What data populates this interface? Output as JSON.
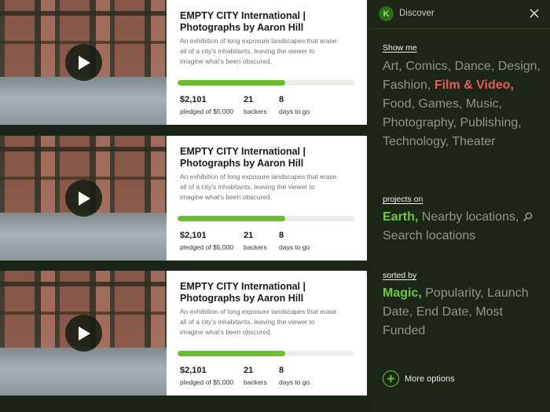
{
  "projects": [
    {
      "title": "EMPTY CITY International | Photographs by Aaron Hill",
      "description": "An exhibition of long exposure landscapes that erase all of a city's inhabitants, leaving the viewer to imagine what's been obscured.",
      "progress_fraction": 0.61,
      "pledged": "$2,101",
      "pledged_label": "pledged of $5,000",
      "backers": "21",
      "backers_label": "backers",
      "days": "8",
      "days_label": "days to go"
    },
    {
      "title": "EMPTY CITY International | Photographs by Aaron Hill",
      "description": "An exhibition of long exposure landscapes that erase all of a city's inhabitants, leaving the viewer to imagine what's been obscured.",
      "progress_fraction": 0.61,
      "pledged": "$2,101",
      "pledged_label": "pledged of $5,000",
      "backers": "21",
      "backers_label": "backers",
      "days": "8",
      "days_label": "days to go"
    },
    {
      "title": "EMPTY CITY International | Photographs by Aaron Hill",
      "description": "An exhibition of long exposure landscapes that erase all of a city's inhabitants, leaving the viewer to imagine what's been obscured.",
      "progress_fraction": 0.61,
      "pledged": "$2,101",
      "pledged_label": "pledged of $5,000",
      "backers": "21",
      "backers_label": "backers",
      "days": "8",
      "days_label": "days to go"
    }
  ],
  "panel": {
    "logo_letter": "K",
    "title": "Discover",
    "close_icon": "close-icon",
    "show_me": {
      "label": "Show me",
      "items": [
        "Art,",
        "Comics,",
        "Dance,",
        "Design,",
        "Fashion,",
        "Film & Video,",
        "Food,",
        "Games,",
        "Music,",
        "Photography,",
        "Publishing,",
        "Technology,",
        "Theater"
      ],
      "selected": "Film & Video,"
    },
    "projects_on": {
      "label": "projects on",
      "items": [
        "Earth,",
        "Nearby locations,",
        "Search locations"
      ],
      "selected": "Earth,"
    },
    "sorted_by": {
      "label": "sorted by",
      "items": [
        "Magic,",
        "Popularity,",
        "Launch Date,",
        "End Date,",
        "Most Funded"
      ],
      "selected": "Magic,"
    },
    "more_options": "More options"
  },
  "colors": {
    "accent_green": "#6ccb32",
    "accent_red": "#ec5a5a",
    "panel_bg": "#1c2616",
    "progress_fill": "#66c02c"
  }
}
